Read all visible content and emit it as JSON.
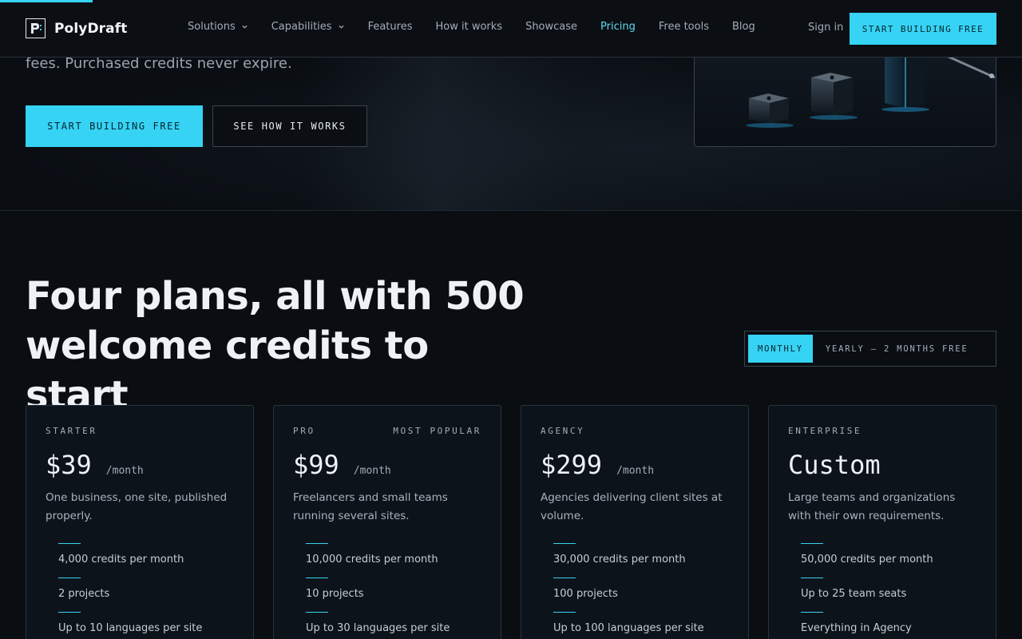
{
  "brand": {
    "name": "PolyDraft",
    "logo_letter": "P"
  },
  "nav": {
    "links": [
      {
        "label": "Solutions",
        "dropdown": true,
        "active": false
      },
      {
        "label": "Capabilities",
        "dropdown": true,
        "active": false
      },
      {
        "label": "Features",
        "dropdown": false,
        "active": false
      },
      {
        "label": "How it works",
        "dropdown": false,
        "active": false
      },
      {
        "label": "Showcase",
        "dropdown": false,
        "active": false
      },
      {
        "label": "Pricing",
        "dropdown": false,
        "active": true
      },
      {
        "label": "Free tools",
        "dropdown": false,
        "active": false
      },
      {
        "label": "Blog",
        "dropdown": false,
        "active": false
      }
    ],
    "sign_in": "Sign in",
    "cta": "START BUILDING FREE"
  },
  "hero": {
    "text_fragment": "fees. Purchased credits never expire.",
    "primary_button": "START BUILDING FREE",
    "secondary_button": "SEE HOW IT WORKS"
  },
  "pricing": {
    "title": "Four plans, all with 500 welcome credits to start",
    "billing": {
      "monthly": "MONTHLY",
      "yearly": "YEARLY — 2 MONTHS FREE",
      "selected": "MONTHLY"
    },
    "plans": [
      {
        "name": "STARTER",
        "tag": "",
        "price": "$39",
        "period": "/month",
        "description": "One business, one site, published properly.",
        "features": [
          "4,000 credits per month",
          "2 projects",
          "Up to 10 languages per site"
        ]
      },
      {
        "name": "PRO",
        "tag": "MOST POPULAR",
        "price": "$99",
        "period": "/month",
        "description": "Freelancers and small teams running several sites.",
        "features": [
          "10,000 credits per month",
          "10 projects",
          "Up to 30 languages per site"
        ]
      },
      {
        "name": "AGENCY",
        "tag": "",
        "price": "$299",
        "period": "/month",
        "description": "Agencies delivering client sites at volume.",
        "features": [
          "30,000 credits per month",
          "100 projects",
          "Up to 100 languages per site"
        ]
      },
      {
        "name": "ENTERPRISE",
        "tag": "",
        "price": "Custom",
        "period": "",
        "description": "Large teams and organizations with their own requirements.",
        "features": [
          "50,000 credits per month",
          "Up to 25 team seats",
          "Everything in Agency"
        ]
      }
    ]
  },
  "colors": {
    "accent": "#36d3f5",
    "background": "#0a0e13",
    "card": "#0d131a"
  }
}
